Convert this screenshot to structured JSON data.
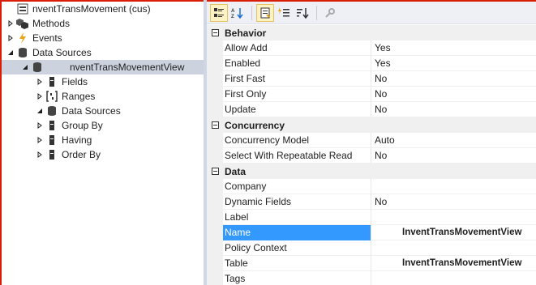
{
  "tree": {
    "items": [
      {
        "label": "nventTransMovement (cus)",
        "icon": "form-icon",
        "expander": "",
        "indent": 0
      },
      {
        "label": "Methods",
        "icon": "methods-icon",
        "expander": "collapsed",
        "indent": 0
      },
      {
        "label": "Events",
        "icon": "events-icon",
        "expander": "collapsed",
        "indent": 0
      },
      {
        "label": "Data Sources",
        "icon": "database-icon",
        "expander": "expanded",
        "indent": 0
      },
      {
        "label": "nventTransMovementView",
        "icon": "datasource-icon",
        "expander": "expanded",
        "indent": 1,
        "selected": true
      },
      {
        "label": "Fields",
        "icon": "fields-icon",
        "expander": "collapsed",
        "indent": 2
      },
      {
        "label": "Ranges",
        "icon": "ranges-icon",
        "expander": "collapsed",
        "indent": 2
      },
      {
        "label": "Data Sources",
        "icon": "database-icon",
        "expander": "expanded",
        "indent": 2
      },
      {
        "label": "Group By",
        "icon": "groupby-icon",
        "expander": "collapsed",
        "indent": 2
      },
      {
        "label": "Having",
        "icon": "having-icon",
        "expander": "collapsed",
        "indent": 2
      },
      {
        "label": "Order By",
        "icon": "orderby-icon",
        "expander": "collapsed",
        "indent": 2
      }
    ]
  },
  "toolbar": {
    "buttons": [
      "categorized-icon",
      "alphabetical-icon",
      "properties-icon",
      "events-list-icon",
      "sort-icon",
      "wrench-icon"
    ]
  },
  "grid": {
    "categories": [
      {
        "name": "Behavior",
        "rows": [
          {
            "name": "Allow Add",
            "value": "Yes"
          },
          {
            "name": "Enabled",
            "value": "Yes"
          },
          {
            "name": "First Fast",
            "value": "No"
          },
          {
            "name": "First Only",
            "value": "No"
          },
          {
            "name": "Update",
            "value": "No"
          }
        ]
      },
      {
        "name": "Concurrency",
        "rows": [
          {
            "name": "Concurrency Model",
            "value": "Auto"
          },
          {
            "name": "Select With Repeatable Read",
            "value": "No"
          }
        ]
      },
      {
        "name": "Data",
        "rows": [
          {
            "name": "Company",
            "value": ""
          },
          {
            "name": "Dynamic Fields",
            "value": "No"
          },
          {
            "name": "Label",
            "value": ""
          },
          {
            "name": "Name",
            "value": "InventTransMovementView",
            "selected": true,
            "bold": true
          },
          {
            "name": "Policy Context",
            "value": ""
          },
          {
            "name": "Table",
            "value": "InventTransMovementView",
            "bold": true
          },
          {
            "name": "Tags",
            "value": ""
          }
        ]
      }
    ]
  },
  "colors": {
    "selection": "#3399ff",
    "tree_selection": "#ccd3de",
    "accent_red": "#d81e06"
  }
}
